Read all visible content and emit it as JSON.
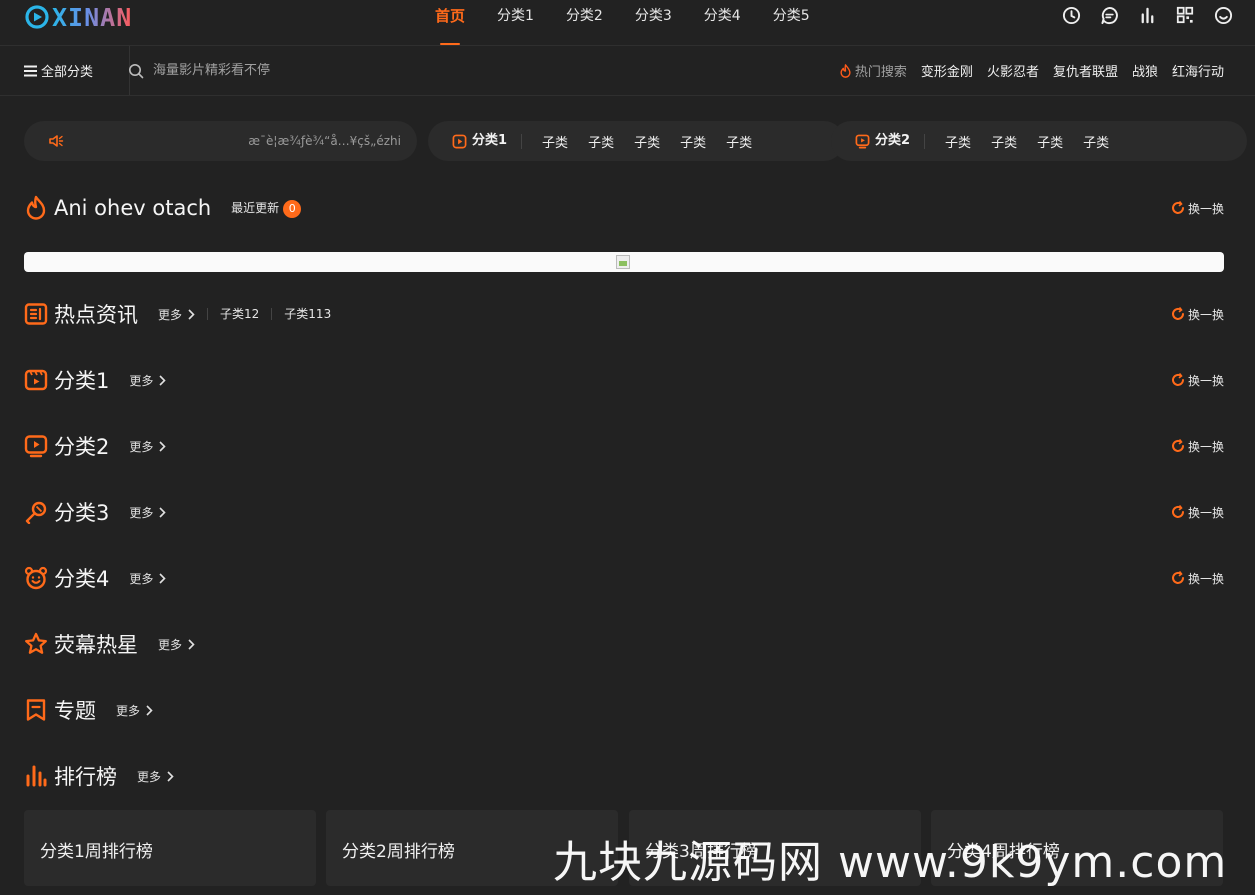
{
  "header": {
    "logo_text": "XINAN",
    "nav": [
      {
        "label": "首页",
        "active": true
      },
      {
        "label": "分类1"
      },
      {
        "label": "分类2"
      },
      {
        "label": "分类3"
      },
      {
        "label": "分类4"
      },
      {
        "label": "分类5"
      }
    ],
    "icons": [
      "clock-icon",
      "message-icon",
      "bar-chart-icon",
      "qrcode-icon",
      "smile-user-icon"
    ]
  },
  "subbar": {
    "all_categories": "全部分类",
    "search_placeholder": "海量影片精彩看不停",
    "hot_label": "热门搜索",
    "hot_keywords": [
      "变形金刚",
      "火影忍者",
      "复仇者联盟",
      "战狼",
      "红海行动"
    ]
  },
  "notice": {
    "text": "æ¯è¦æ¾ƒè¾“å…¥çš„ézhi"
  },
  "pills": [
    {
      "title": "分类1",
      "subs": [
        "子类",
        "子类",
        "子类",
        "子类",
        "子类"
      ]
    },
    {
      "title": "分类2",
      "subs": [
        "子类",
        "子类",
        "子类",
        "子类"
      ]
    }
  ],
  "sections": {
    "latest": {
      "title": "Ani ohev otach",
      "badge_label": "最近更新",
      "badge_count": "0",
      "refresh": "换一换"
    },
    "news": {
      "title": "热点资讯",
      "more": "更多",
      "tags": [
        "子类12",
        "子类113"
      ],
      "refresh": "换一换"
    },
    "cat1": {
      "title": "分类1",
      "more": "更多",
      "refresh": "换一换"
    },
    "cat2": {
      "title": "分类2",
      "more": "更多",
      "refresh": "换一换"
    },
    "cat3": {
      "title": "分类3",
      "more": "更多",
      "refresh": "换一换"
    },
    "cat4": {
      "title": "分类4",
      "more": "更多",
      "refresh": "换一换"
    },
    "stars": {
      "title": "荧幕热星",
      "more": "更多"
    },
    "topics": {
      "title": "专题",
      "more": "更多"
    },
    "ranking": {
      "title": "排行榜",
      "more": "更多"
    }
  },
  "ranking_cards": [
    "分类1周排行榜",
    "分类2周排行榜",
    "分类3周排行榜",
    "分类4周排行榜"
  ],
  "watermark": "九块九源码网 www.9k9ym.com",
  "colors": {
    "accent": "#ff6a1a",
    "background": "#222222",
    "card": "#2b2b2b"
  }
}
